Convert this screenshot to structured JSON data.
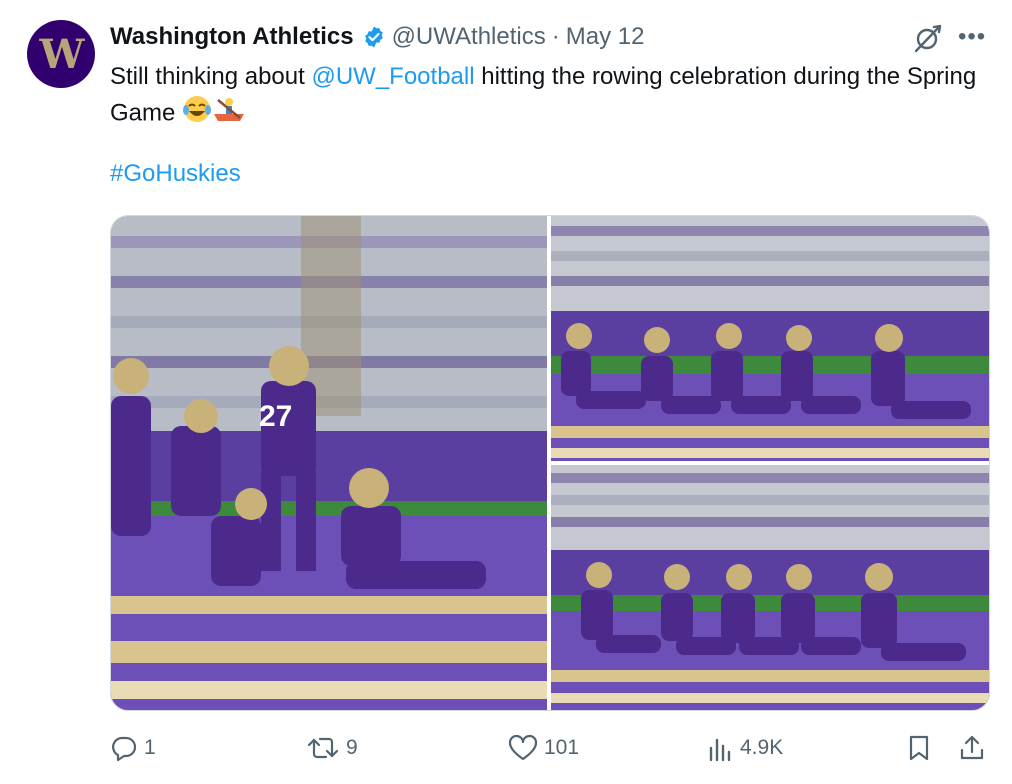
{
  "author": {
    "display_name": "Washington Athletics",
    "handle": "@UWAthletics",
    "separator": "·",
    "date": "May 12",
    "avatar_letter": "W",
    "verified": true
  },
  "tweet": {
    "text_before": "Still thinking about ",
    "mention": "@UW_Football",
    "text_after": " hitting the rowing celebration during the Spring Game ",
    "emoji": [
      "face-with-tears-of-joy",
      "person-rowing-boat"
    ],
    "hashtag": "#GoHuskies"
  },
  "media": {
    "count": 3
  },
  "actions": {
    "replies": "1",
    "reposts": "9",
    "likes": "101",
    "views": "4.9K"
  },
  "colors": {
    "link": "#1d9bf0",
    "muted": "#536471",
    "uw_purple": "#32006e",
    "uw_gold": "#b7a57a",
    "verified": "#1d9bf0"
  }
}
